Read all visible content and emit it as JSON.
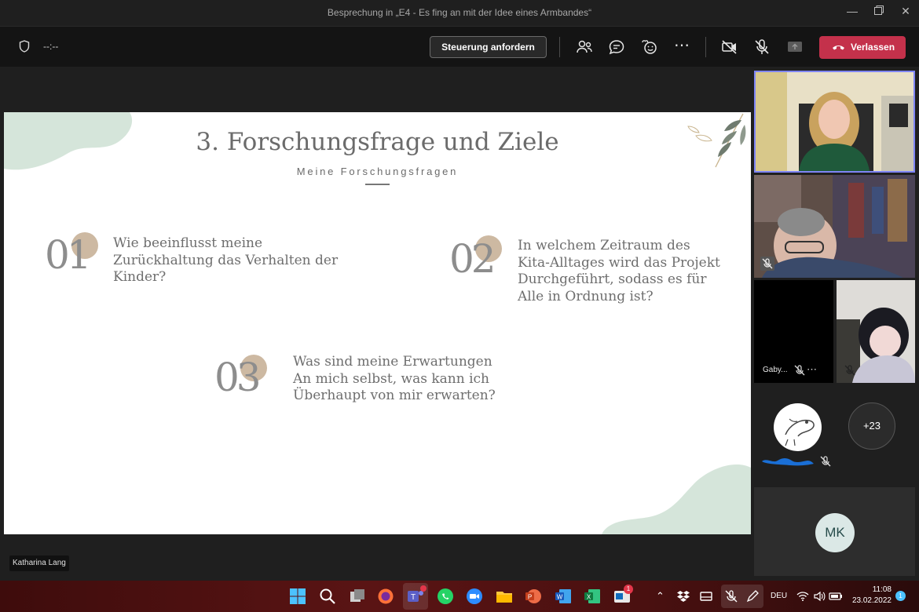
{
  "window": {
    "title": "Besprechung in „E4 - Es fing an mit der Idee eines Armbandes“"
  },
  "toolbar": {
    "timer": "--:--",
    "control_label": "Steuerung anfordern",
    "leave_label": "Verlassen",
    "leave_color": "#c4314b"
  },
  "slide": {
    "title": "3. Forschungsfrage und Ziele",
    "subtitle": "Meine Forschungsfragen",
    "questions": [
      {
        "number": "01",
        "text_lines": [
          "Wie beeinflusst meine",
          "Zurückhaltung das Verhalten der",
          "Kinder?"
        ]
      },
      {
        "number": "02",
        "text_lines": [
          "In welchem Zeitraum des",
          "Kita-Alltages wird das Projekt",
          "Durchgeführt, sodass es für",
          "Alle in Ordnung ist?"
        ]
      },
      {
        "number": "03",
        "text_lines": [
          "Was sind meine Erwartungen",
          "An mich selbst, was kann ich",
          "Überhaupt von mir erwarten?"
        ]
      }
    ],
    "accent_circle_color": "#cdb9a2",
    "blob_color": "#d5e5da"
  },
  "presenter": {
    "name": "Katharina Lang"
  },
  "participants": {
    "gaby_label": "Gaby...",
    "more_count": "+23",
    "mk_initials": "MK"
  },
  "taskbar": {
    "language": "DEU",
    "time": "11:08",
    "date": "23.02.2022",
    "notification_count": "1",
    "teams_badge": "1"
  }
}
